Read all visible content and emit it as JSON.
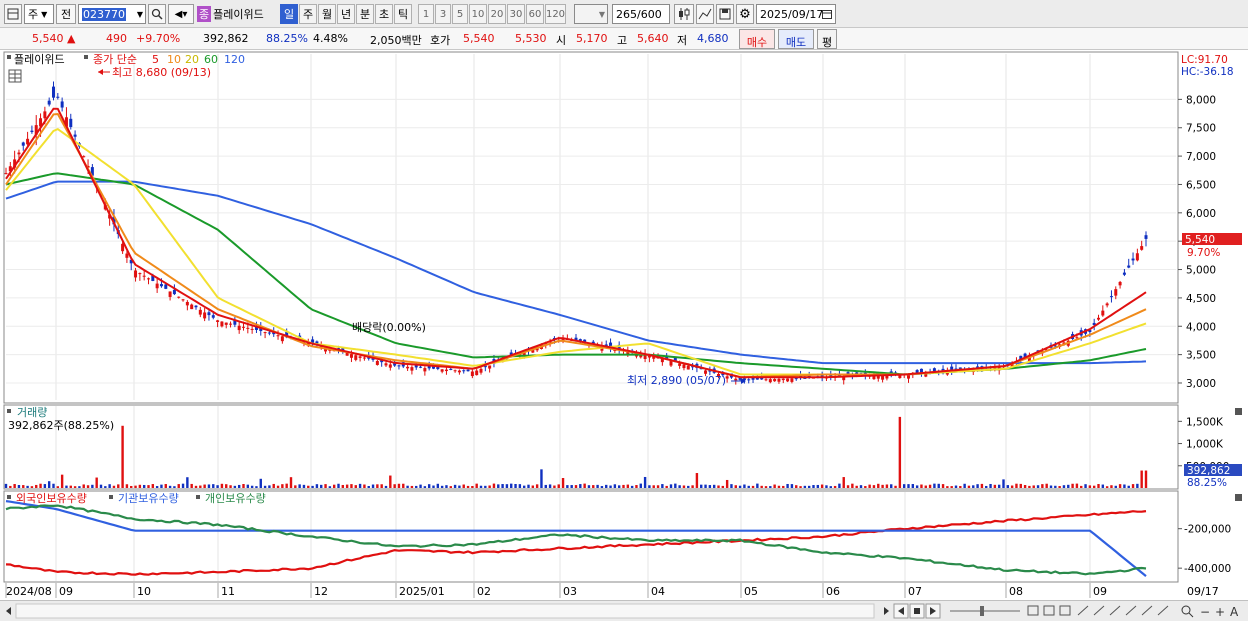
{
  "toolbar": {
    "market": "주",
    "prev": "전",
    "code": "023770",
    "stock_name": "플레이위드",
    "stock_tag": "종",
    "periods": [
      "일",
      "주",
      "월",
      "년",
      "분",
      "초",
      "틱"
    ],
    "intervals": [
      "1",
      "3",
      "5",
      "10",
      "20",
      "30",
      "60",
      "120"
    ],
    "count_shown": "265",
    "count_total": "/600",
    "date": "2025/09/17"
  },
  "quote": {
    "price": "5,540",
    "arrow": "▲",
    "change": "490",
    "change_pct": "+9.70%",
    "volume": "392,862",
    "volume_pct": "88.25%",
    "turnover_pct": "4.48%",
    "amount": "2,050백만",
    "hoga_label": "호가",
    "ask": "5,540",
    "bid": "5,530",
    "open_label": "시",
    "open": "5,170",
    "high_label": "고",
    "high": "5,640",
    "low_label": "저",
    "low": "4,680",
    "buy_label": "매수",
    "sell_label": "매도",
    "eval_label": "평"
  },
  "price_panel": {
    "name_label": "플레이위드",
    "ma_label": "종가 단순",
    "ma_periods": [
      "5",
      "10",
      "20",
      "60",
      "120"
    ],
    "high_marker": "최고 8,680 (09/13)",
    "low_marker": "최저 2,890 (05/07)",
    "dividend_marker": "배당락(0.00%)",
    "lc": "LC:91.70",
    "hc": "HC:-36.18",
    "current_price": "5,540",
    "current_pct": "9.70%",
    "yticks": [
      "8,000",
      "7,500",
      "7,000",
      "6,500",
      "6,000",
      "5,500",
      "5,000",
      "4,500",
      "4,000",
      "3,500",
      "3,000"
    ]
  },
  "volume_panel": {
    "title": "거래량",
    "info": "392,862주(88.25%)",
    "yticks": [
      "1,500K",
      "1,000K",
      "500,000"
    ],
    "current": "392,862",
    "current_pct": "88.25%"
  },
  "holding_panel": {
    "legend": [
      "외국인보유수량",
      "기관보유수량",
      "개인보유수량"
    ],
    "yticks": [
      "-200,000",
      "-400,000"
    ]
  },
  "xaxis": [
    "2024/08",
    "09",
    "10",
    "11",
    "12",
    "2025/01",
    "02",
    "03",
    "04",
    "05",
    "06",
    "07",
    "08",
    "09",
    "09/17"
  ],
  "colors": {
    "ma5": "#e01010",
    "ma10": "#f08a1a",
    "ma20": "#f2e030",
    "ma60": "#1a9a2a",
    "ma120": "#3060e0",
    "up": "#e01010",
    "down": "#1030c0",
    "foreign": "#e01010",
    "institution": "#3060e0",
    "individual": "#2a8a4a"
  },
  "chart_data": {
    "type": "candlestick",
    "title": "플레이위드",
    "ylim": [
      2700,
      8800
    ],
    "x": [
      "2024/08",
      "2024/09",
      "2024/10",
      "2024/11",
      "2024/12",
      "2025/01",
      "2025/02",
      "2025/03",
      "2025/04",
      "2025/05",
      "2025/06",
      "2025/07",
      "2025/08",
      "2025/09",
      "2025/09/17"
    ],
    "close": [
      6700,
      8100,
      5000,
      4100,
      3700,
      3300,
      3200,
      3800,
      3500,
      3050,
      3100,
      3150,
      3300,
      3900,
      5540
    ],
    "series": [
      {
        "name": "5",
        "values": [
          6600,
          7900,
          5100,
          4200,
          3700,
          3350,
          3250,
          3800,
          3500,
          3100,
          3100,
          3150,
          3300,
          3950,
          4600
        ]
      },
      {
        "name": "10",
        "values": [
          6500,
          7800,
          5300,
          4300,
          3650,
          3400,
          3250,
          3750,
          3500,
          3100,
          3150,
          3150,
          3300,
          3850,
          4300
        ]
      },
      {
        "name": "20",
        "values": [
          6400,
          7500,
          6500,
          4500,
          3700,
          3500,
          3300,
          3550,
          3700,
          3150,
          3150,
          3150,
          3250,
          3700,
          4050
        ]
      },
      {
        "name": "60",
        "values": [
          6500,
          6700,
          6500,
          5700,
          4300,
          3700,
          3450,
          3500,
          3500,
          3350,
          3250,
          3150,
          3250,
          3400,
          3600
        ]
      },
      {
        "name": "120",
        "values": [
          6250,
          6550,
          6550,
          6300,
          5800,
          5200,
          4600,
          4200,
          3750,
          3500,
          3350,
          3350,
          3350,
          3350,
          3380
        ]
      }
    ],
    "volume_ylim": [
      0,
      1800000
    ],
    "volume_latest": 392862,
    "holdings": [
      {
        "name": "외국인보유수량",
        "values": [
          -380000,
          -420000,
          -430000,
          -420000,
          -400000,
          -310000,
          -320000,
          -300000,
          -280000,
          -260000,
          -240000,
          -200000,
          -160000,
          -130000,
          -110000
        ]
      },
      {
        "name": "기관보유수량",
        "values": [
          -60000,
          -100000,
          -210000,
          -210000,
          -210000,
          -210000,
          -210000,
          -210000,
          -210000,
          -210000,
          -210000,
          -210000,
          -210000,
          -210000,
          -440000
        ]
      },
      {
        "name": "개인보유수량",
        "values": [
          -100000,
          -80000,
          -150000,
          -180000,
          -240000,
          -290000,
          -280000,
          -230000,
          -260000,
          -260000,
          -320000,
          -350000,
          -410000,
          -430000,
          -400000
        ]
      }
    ]
  }
}
